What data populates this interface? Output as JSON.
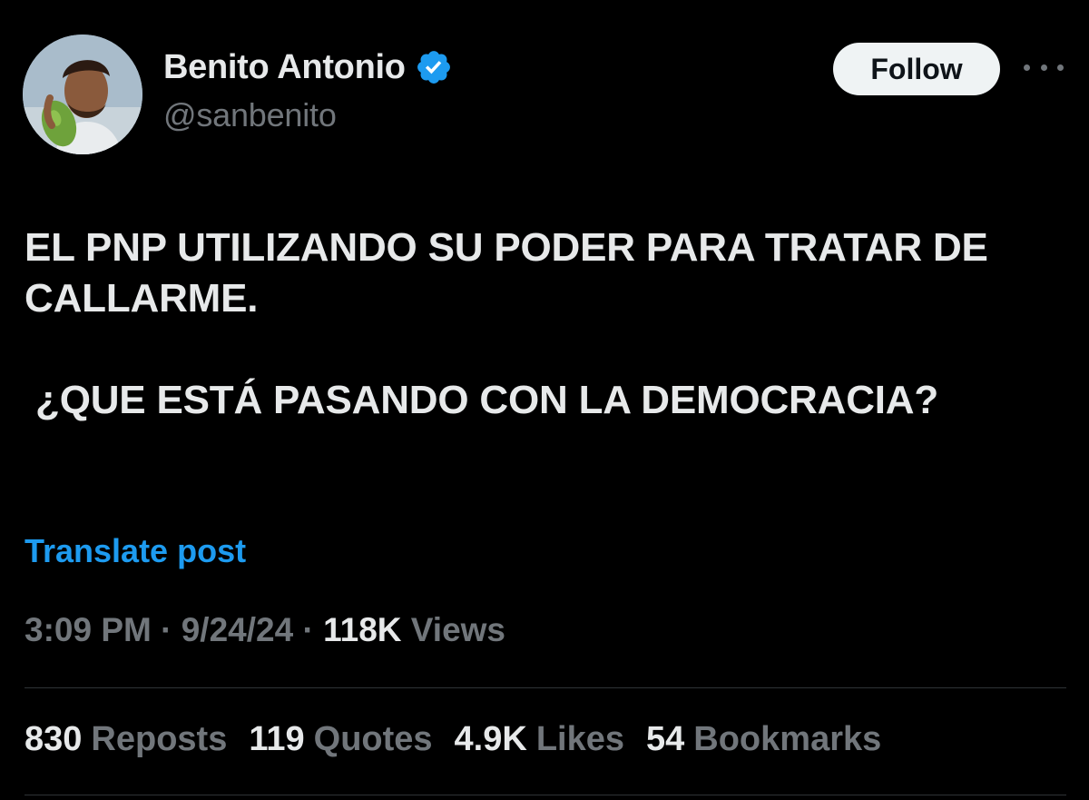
{
  "author": {
    "display_name": "Benito Antonio",
    "handle": "@sanbenito",
    "verified_icon": "verified-badge-icon",
    "verified_color": "#1d9bf0"
  },
  "actions": {
    "follow_label": "Follow",
    "more_icon": "more-dots-icon"
  },
  "post": {
    "line1": "EL PNP UTILIZANDO SU PODER PARA TRATAR DE CALLARME.",
    "line2": " ¿QUE ESTÁ PASANDO CON LA DEMOCRACIA?",
    "translate_label": "Translate post"
  },
  "meta": {
    "time": "3:09 PM",
    "separator1": "·",
    "date": "9/24/24",
    "separator2": "·",
    "views_count": "118K",
    "views_label": "Views"
  },
  "stats": [
    {
      "count": "830",
      "label": "Reposts"
    },
    {
      "count": "119",
      "label": "Quotes"
    },
    {
      "count": "4.9K",
      "label": "Likes"
    },
    {
      "count": "54",
      "label": "Bookmarks"
    }
  ],
  "colors": {
    "background": "#000000",
    "text_primary": "#e7e9ea",
    "text_secondary": "#71767b",
    "accent": "#1d9bf0",
    "divider": "#2f3336"
  }
}
